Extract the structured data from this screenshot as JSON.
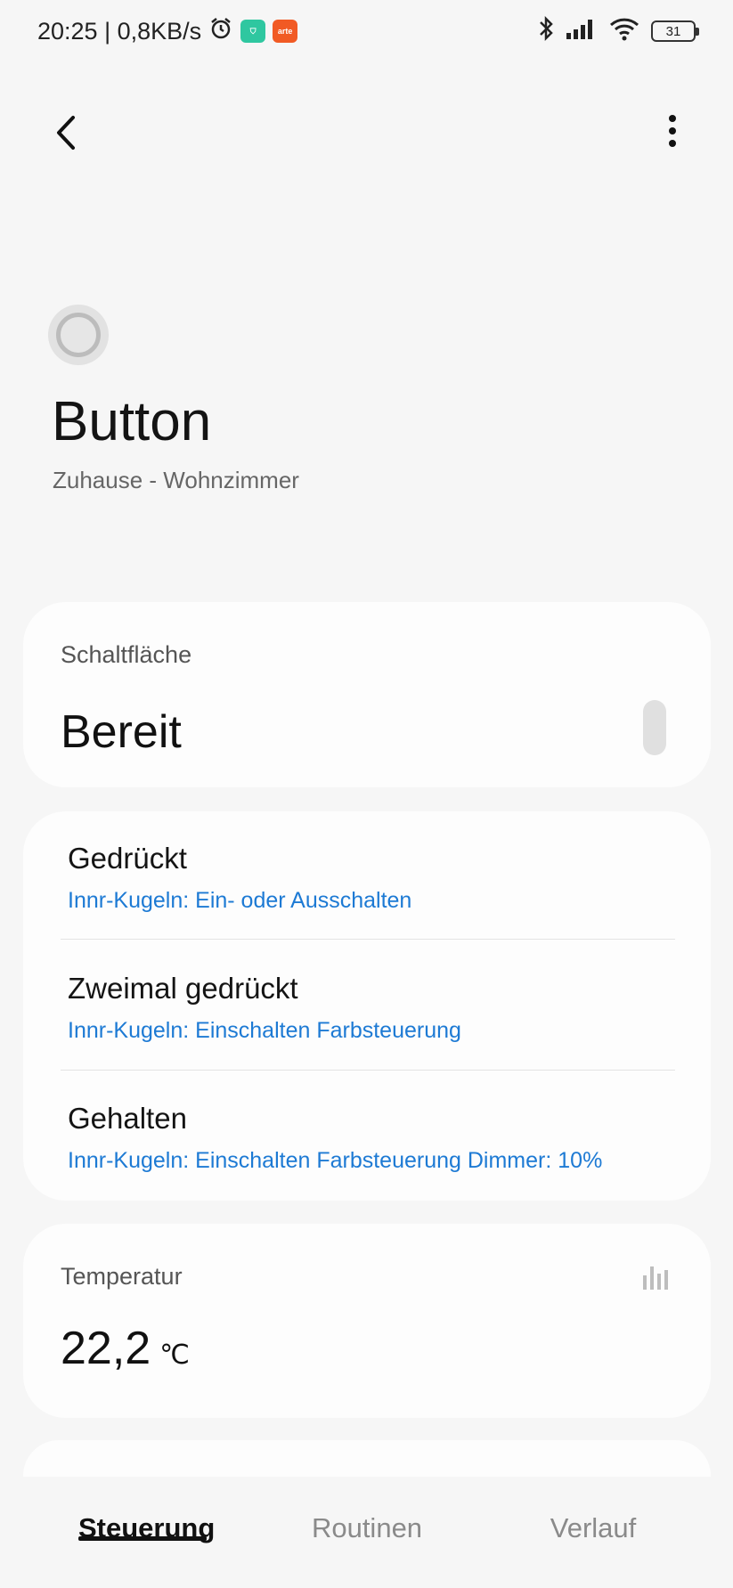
{
  "status_bar": {
    "time_speed": "20:25 | 0,8KB/s",
    "badge_shield": "⛉",
    "badge_app": "arte",
    "battery": "31"
  },
  "device": {
    "title": "Button",
    "location": "Zuhause - Wohnzimmer"
  },
  "switch_card": {
    "label": "Schaltfläche",
    "value": "Bereit"
  },
  "actions": [
    {
      "title": "Gedrückt",
      "desc": "Innr-Kugeln: Ein- oder Ausschalten"
    },
    {
      "title": "Zweimal gedrückt",
      "desc": "Innr-Kugeln: Einschalten Farbsteuerung"
    },
    {
      "title": "Gehalten",
      "desc": "Innr-Kugeln: Einschalten Farbsteuerung Dimmer: 10%"
    }
  ],
  "temperature": {
    "label": "Temperatur",
    "value": "22,2",
    "unit": "℃"
  },
  "tabs": [
    {
      "label": "Steuerung"
    },
    {
      "label": "Routinen"
    },
    {
      "label": "Verlauf"
    }
  ],
  "colors": {
    "accent_link": "#1d7ad4",
    "background": "#f6f6f6",
    "card": "#fdfdfd"
  }
}
